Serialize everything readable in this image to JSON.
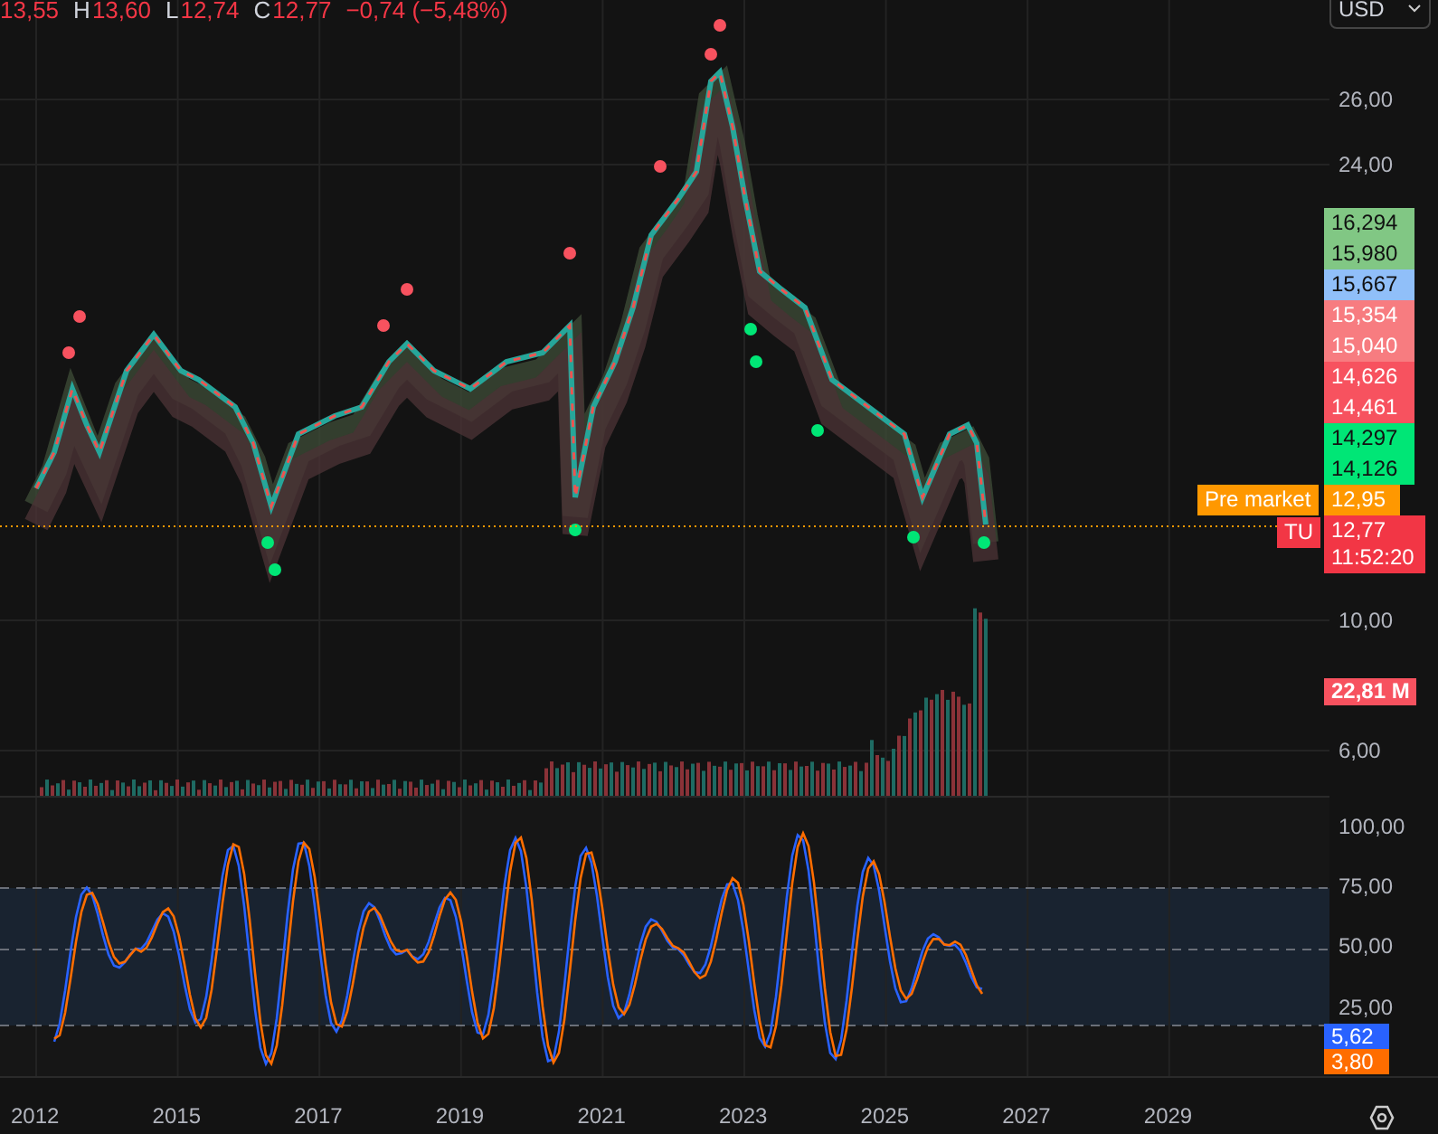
{
  "legend": [
    {
      "value": "13,55"
    },
    {
      "key": "H",
      "value": "13,60"
    },
    {
      "key": "L",
      "value": "12,74"
    },
    {
      "key": "C",
      "value": "12,77"
    },
    {
      "value": "−0,74 (−5,48%)"
    }
  ],
  "currency": "USD",
  "price_axis": [
    "26,00",
    "24,00",
    "10,00",
    "6,00"
  ],
  "price_labels": [
    {
      "text": "16,294",
      "color": "#81c784",
      "dark_text": true
    },
    {
      "text": "15,980",
      "color": "#81c784",
      "dark_text": true
    },
    {
      "text": "15,667",
      "color": "#90bff9",
      "dark_text": true
    },
    {
      "text": "15,354",
      "color": "#f77c80",
      "dark_text": false
    },
    {
      "text": "15,040",
      "color": "#f77c80",
      "dark_text": false
    },
    {
      "text": "14,626",
      "color": "#f7525f",
      "dark_text": false
    },
    {
      "text": "14,461",
      "color": "#f7525f",
      "dark_text": false
    },
    {
      "text": "14,297",
      "color": "#00e676",
      "dark_text": true
    },
    {
      "text": "14,126",
      "color": "#00e676",
      "dark_text": true
    }
  ],
  "premarket": {
    "label": "Pre market",
    "price": "12,95"
  },
  "last": {
    "symbol": "TU",
    "price": "12,77",
    "countdown": "11:52:20"
  },
  "volume_label": "22,81 M",
  "oscillator_axis": [
    "100,00",
    "75,00",
    "50,00",
    "25,00"
  ],
  "oscillator_labels": [
    {
      "text": "5,62",
      "color": "#2962ff"
    },
    {
      "text": "3,80",
      "color": "#ff6d00"
    }
  ],
  "time_axis": [
    "2012",
    "2015",
    "2017",
    "2019",
    "2021",
    "2023",
    "2025",
    "2027",
    "2029"
  ]
}
